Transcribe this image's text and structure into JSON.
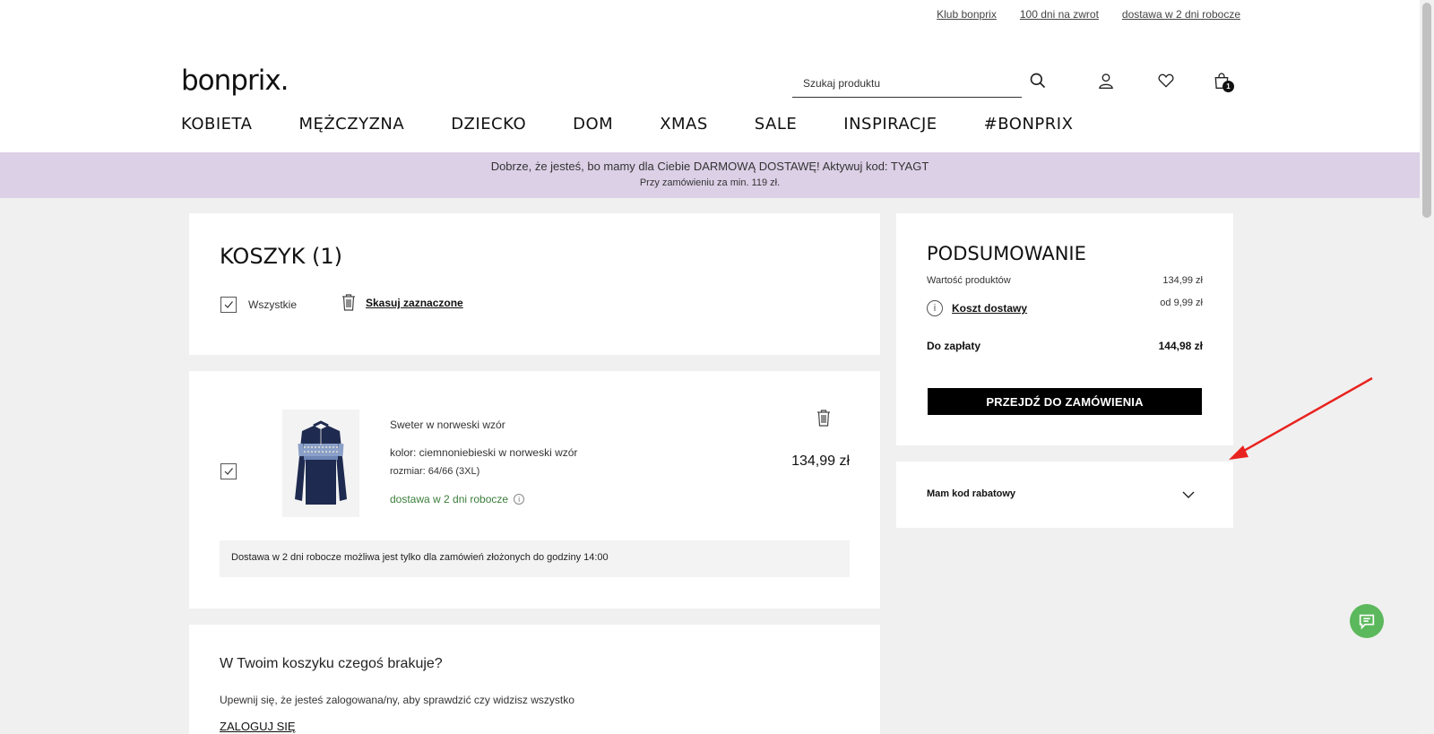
{
  "toplinks": [
    "Klub bonprix",
    "100 dni na zwrot",
    "dostawa w 2 dni robocze"
  ],
  "logo": "bonprix.",
  "search": {
    "placeholder": "Szukaj produktu"
  },
  "cart_count": "1",
  "nav": [
    "KOBIETA",
    "MĘŻCZYZNA",
    "DZIECKO",
    "DOM",
    "XMAS",
    "SALE",
    "INSPIRACJE",
    "#BONPRIX"
  ],
  "promo": {
    "line1": "Dobrze, że jesteś, bo mamy dla Ciebie DARMOWĄ DOSTAWĘ! Aktywuj kod: TYAGT",
    "line2": "Przy zamówieniu za min. 119 zł."
  },
  "cart": {
    "title": "KOSZYK (1)",
    "select_all": "Wszystkie",
    "delete_selected": "Skasuj zaznaczone"
  },
  "item": {
    "name": "Sweter w norweski wzór",
    "color": "kolor: ciemnoniebieski w norweski wzór",
    "size": "rozmiar: 64/66 (3XL)",
    "delivery": "dostawa w 2 dni robocze",
    "price": "134,99 zł",
    "note": "Dostawa w 2 dni robocze możliwa jest tylko dla zamówień złożonych do godziny 14:00"
  },
  "missing": {
    "title": "W Twoim koszyku czegoś brakuje?",
    "text": "Upewnij się, że jesteś zalogowana/ny, aby sprawdzić czy widzisz wszystko",
    "login": "ZALOGUJ SIĘ"
  },
  "summary": {
    "title": "PODSUMOWANIE",
    "products_label": "Wartość produktów",
    "products_value": "134,99 zł",
    "shipping_label": "Koszt dostawy",
    "shipping_value": "od 9,99 zł",
    "total_label": "Do zapłaty",
    "total_value": "144,98 zł",
    "order_button": "PRZEJDŹ DO ZAMÓWIENIA"
  },
  "coupon": {
    "label": "Mam kod rabatowy"
  },
  "colors": {
    "promo_bg": "#dcd0e7",
    "delivery_green": "#3a7d3a",
    "chat_green": "#5cb85c",
    "annotation_arrow": "#e8231f"
  }
}
